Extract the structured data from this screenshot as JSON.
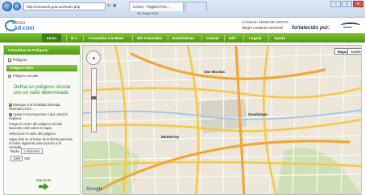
{
  "browser": {
    "address": "http://censonet.gob.mx/index.php",
    "tabs": [
      {
        "label": "Censo - Pagina Princ..."
      },
      {
        "label": ""
      }
    ],
    "toolbar_text": "Sin Regis 2011"
  },
  "header": {
    "logo_line1": "censo",
    "logo_line2": "kd.com",
    "contact_label": "Contacto: 01800-MI-CENTO",
    "skype_label": "Skype contacto.censonet",
    "fortalecido": "fortalecido por:",
    "partner": "sanzz"
  },
  "nav": {
    "items": [
      {
        "label": "Inicio",
        "active": true
      },
      {
        "label": "Ib 1"
      },
      {
        "label": "Consultas a la Base"
      },
      {
        "label": "Mis Consultas"
      },
      {
        "label": "Estadisticas"
      },
      {
        "label": "Cuenta"
      },
      {
        "label": "Info"
      },
      {
        "label": "Logout"
      },
      {
        "label": "Ayuda"
      }
    ]
  },
  "panel": {
    "title": "Consultas en Poligono",
    "check_label": "Poligono",
    "section": "Poligono libre",
    "radio_label": "Poligono circular",
    "define_text": "Defina un poligono circular con un radio determinado",
    "instructions": [
      "Navegue a la localidad deseada, haciendo zoom...",
      "Ajuste el acercamiento a que usted lo requiera.",
      "Ponga el centro del poligono circular haciendo click sobre el mapa.",
      "Seleccione el radio del poligono.",
      "Haga click en el boton de la flecha presione el boton siguiente para acceder a la consulta."
    ],
    "radio_field_label": "Radio",
    "radio_value": "1 Kilometro",
    "color_value": "1000",
    "color_unit": "Mts",
    "action_label": "Siguiente"
  },
  "map": {
    "types": [
      "Mapa",
      "Satelite"
    ],
    "labels": [
      {
        "text": "Monterrey"
      },
      {
        "text": "Guadalupe"
      },
      {
        "text": "San Nicolas"
      }
    ]
  }
}
